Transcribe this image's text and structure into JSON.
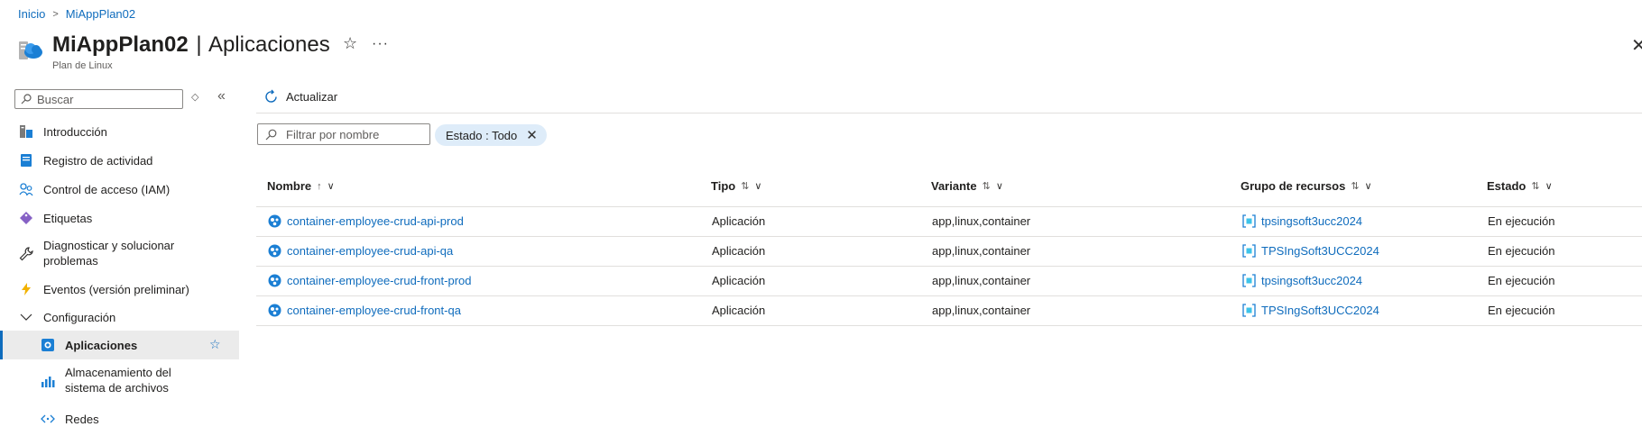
{
  "breadcrumb": {
    "home": "Inicio",
    "current": "MiAppPlan02"
  },
  "header": {
    "name": "MiAppPlan02",
    "separator": "|",
    "section": "Aplicaciones",
    "subtitle": "Plan de Linux",
    "star": "☆",
    "more": "···",
    "close": "✕"
  },
  "sidebar": {
    "search_placeholder": "Buscar",
    "items": [
      {
        "label": "Introducción",
        "icon": "overview-icon"
      },
      {
        "label": "Registro de actividad",
        "icon": "activity-log-icon"
      },
      {
        "label": "Control de acceso (IAM)",
        "icon": "iam-icon"
      },
      {
        "label": "Etiquetas",
        "icon": "tag-icon"
      },
      {
        "label": "Diagnosticar y solucionar problemas",
        "icon": "wrench-icon"
      },
      {
        "label": "Eventos (versión preliminar)",
        "icon": "lightning-icon"
      },
      {
        "label": "Configuración",
        "icon": "chevron-down-icon"
      },
      {
        "label": "Aplicaciones",
        "icon": "app-service-icon"
      },
      {
        "label": "Almacenamiento del sistema de archivos",
        "icon": "storage-chart-icon"
      },
      {
        "label": "Redes",
        "icon": "network-icon"
      }
    ]
  },
  "toolbar": {
    "refresh_label": "Actualizar"
  },
  "filters": {
    "name_placeholder": "Filtrar por nombre",
    "status_key": "Estado : ",
    "status_value": "Todo"
  },
  "table": {
    "columns": [
      {
        "label": "Nombre",
        "sort": "↑"
      },
      {
        "label": "Tipo",
        "sort": "⇅"
      },
      {
        "label": "Variante",
        "sort": "⇅"
      },
      {
        "label": "Grupo de recursos",
        "sort": "⇅"
      },
      {
        "label": "Estado",
        "sort": "⇅"
      }
    ],
    "rows": [
      {
        "name": "container-employee-crud-api-prod",
        "type": "Aplicación",
        "variant": "app,linux,container",
        "group": "tpsingsoft3ucc2024",
        "status": "En ejecución"
      },
      {
        "name": "container-employee-crud-api-qa",
        "type": "Aplicación",
        "variant": "app,linux,container",
        "group": "TPSIngSoft3UCC2024",
        "status": "En ejecución"
      },
      {
        "name": "container-employee-crud-front-prod",
        "type": "Aplicación",
        "variant": "app,linux,container",
        "group": "tpsingsoft3ucc2024",
        "status": "En ejecución"
      },
      {
        "name": "container-employee-crud-front-qa",
        "type": "Aplicación",
        "variant": "app,linux,container",
        "group": "TPSIngSoft3UCC2024",
        "status": "En ejecución"
      }
    ]
  },
  "colors": {
    "accent": "#0f6cbd",
    "pill_bg": "#deecf9",
    "active_bg": "#ebebeb"
  }
}
